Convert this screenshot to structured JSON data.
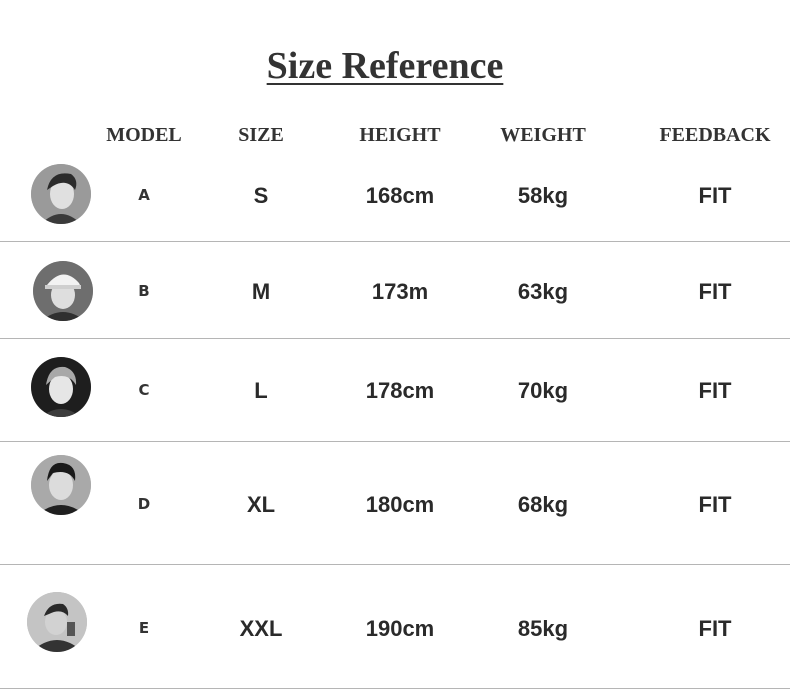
{
  "title": "Size Reference",
  "headers": {
    "model": "MODEL",
    "size": "SIZE",
    "height": "HEIGHT",
    "weight": "WEIGHT",
    "feedback": "FEEDBACK"
  },
  "rows": [
    {
      "model": "A",
      "size": "S",
      "height": "168cm",
      "weight": "58kg",
      "feedback": "FIT"
    },
    {
      "model": "B",
      "size": "M",
      "height": "173m",
      "weight": "63kg",
      "feedback": "FIT"
    },
    {
      "model": "C",
      "size": "L",
      "height": "178cm",
      "weight": "70kg",
      "feedback": "FIT"
    },
    {
      "model": "D",
      "size": "XL",
      "height": "180cm",
      "weight": "68kg",
      "feedback": "FIT"
    },
    {
      "model": "E",
      "size": "XXL",
      "height": "190cm",
      "weight": "85kg",
      "feedback": "FIT"
    }
  ]
}
